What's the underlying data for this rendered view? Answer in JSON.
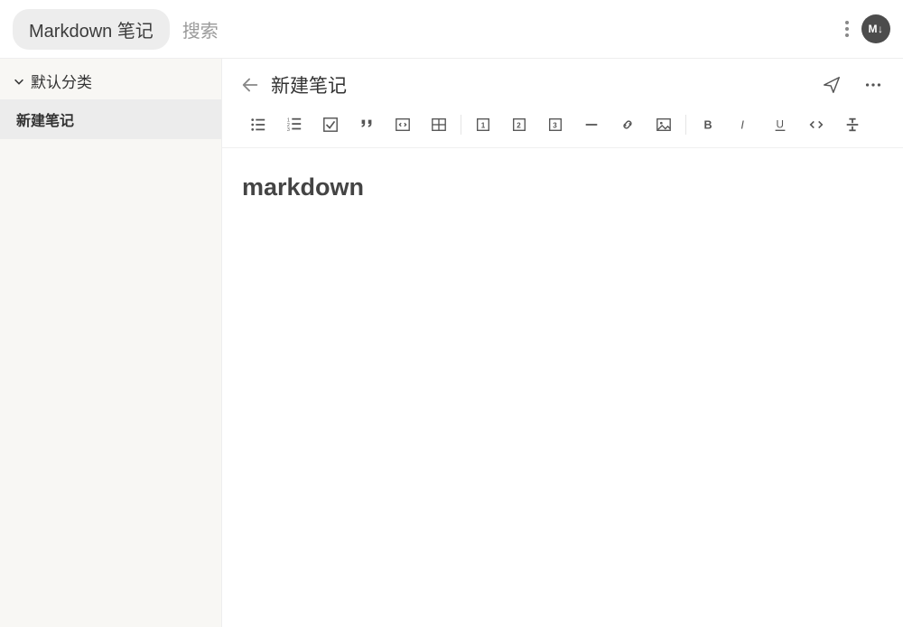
{
  "header": {
    "app_badge": "Markdown 笔记",
    "search_placeholder": "搜索",
    "avatar_label": "M↓"
  },
  "sidebar": {
    "category": "默认分类",
    "items": [
      {
        "label": "新建笔记"
      }
    ]
  },
  "editor": {
    "title": "新建笔记",
    "content": "markdown"
  },
  "toolbar": {
    "icons": [
      "unordered-list",
      "ordered-list",
      "checkbox",
      "quote",
      "code-block",
      "table",
      "sep",
      "heading-1",
      "heading-2",
      "heading-3",
      "divider",
      "link",
      "image",
      "sep",
      "bold",
      "italic",
      "underline",
      "code-inline",
      "strikethrough"
    ]
  }
}
